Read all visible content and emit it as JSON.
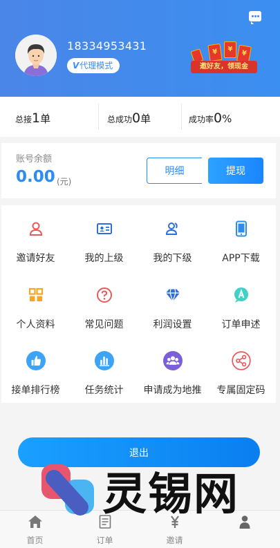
{
  "header": {
    "phone": "18334953431",
    "badge_label": "代理模式",
    "promo_text": "邀好友，领现金"
  },
  "stats": [
    {
      "prefix": "总接",
      "value": "1",
      "suffix": "单"
    },
    {
      "prefix": "总成功",
      "value": "0",
      "suffix": "单"
    },
    {
      "prefix": "成功率",
      "value": "0",
      "suffix": "%"
    }
  ],
  "balance": {
    "label": "账号余额",
    "amount": "0.00",
    "unit": "(元)",
    "detail_button": "明细",
    "withdraw_button": "提现"
  },
  "menu": [
    {
      "label": "邀请好友",
      "icon": "user-icon",
      "color": "#e85a5a"
    },
    {
      "label": "我的上级",
      "icon": "id-card-icon",
      "color": "#2d6fd6"
    },
    {
      "label": "我的下级",
      "icon": "users-icon",
      "color": "#2d6fd6"
    },
    {
      "label": "APP下载",
      "icon": "phone-icon",
      "color": "#2d8cf0"
    },
    {
      "label": "个人资料",
      "icon": "grid-icon",
      "color": "#f5a623"
    },
    {
      "label": "常见问题",
      "icon": "question-icon",
      "color": "#e85a5a"
    },
    {
      "label": "利润设置",
      "icon": "diamond-icon",
      "color": "#2d6fd6"
    },
    {
      "label": "订单申述",
      "icon": "appeal-icon",
      "color": "#3ed1c6"
    },
    {
      "label": "接单排行榜",
      "icon": "thumbs-up-icon",
      "color": "#3da3f5"
    },
    {
      "label": "任务统计",
      "icon": "bar-chart-icon",
      "color": "#3da3f5"
    },
    {
      "label": "申请成为地推",
      "icon": "group-icon",
      "color": "#7a5fd8"
    },
    {
      "label": "专属固定码",
      "icon": "share-icon",
      "color": "#e85a5a"
    }
  ],
  "logout_label": "退出",
  "watermark_text": "灵锡网",
  "tabs": [
    {
      "label": "首页",
      "icon": "home-icon"
    },
    {
      "label": "订单",
      "icon": "order-icon"
    },
    {
      "label": "邀请",
      "icon": "yuan-icon"
    },
    {
      "label": "",
      "icon": "person-icon"
    }
  ]
}
